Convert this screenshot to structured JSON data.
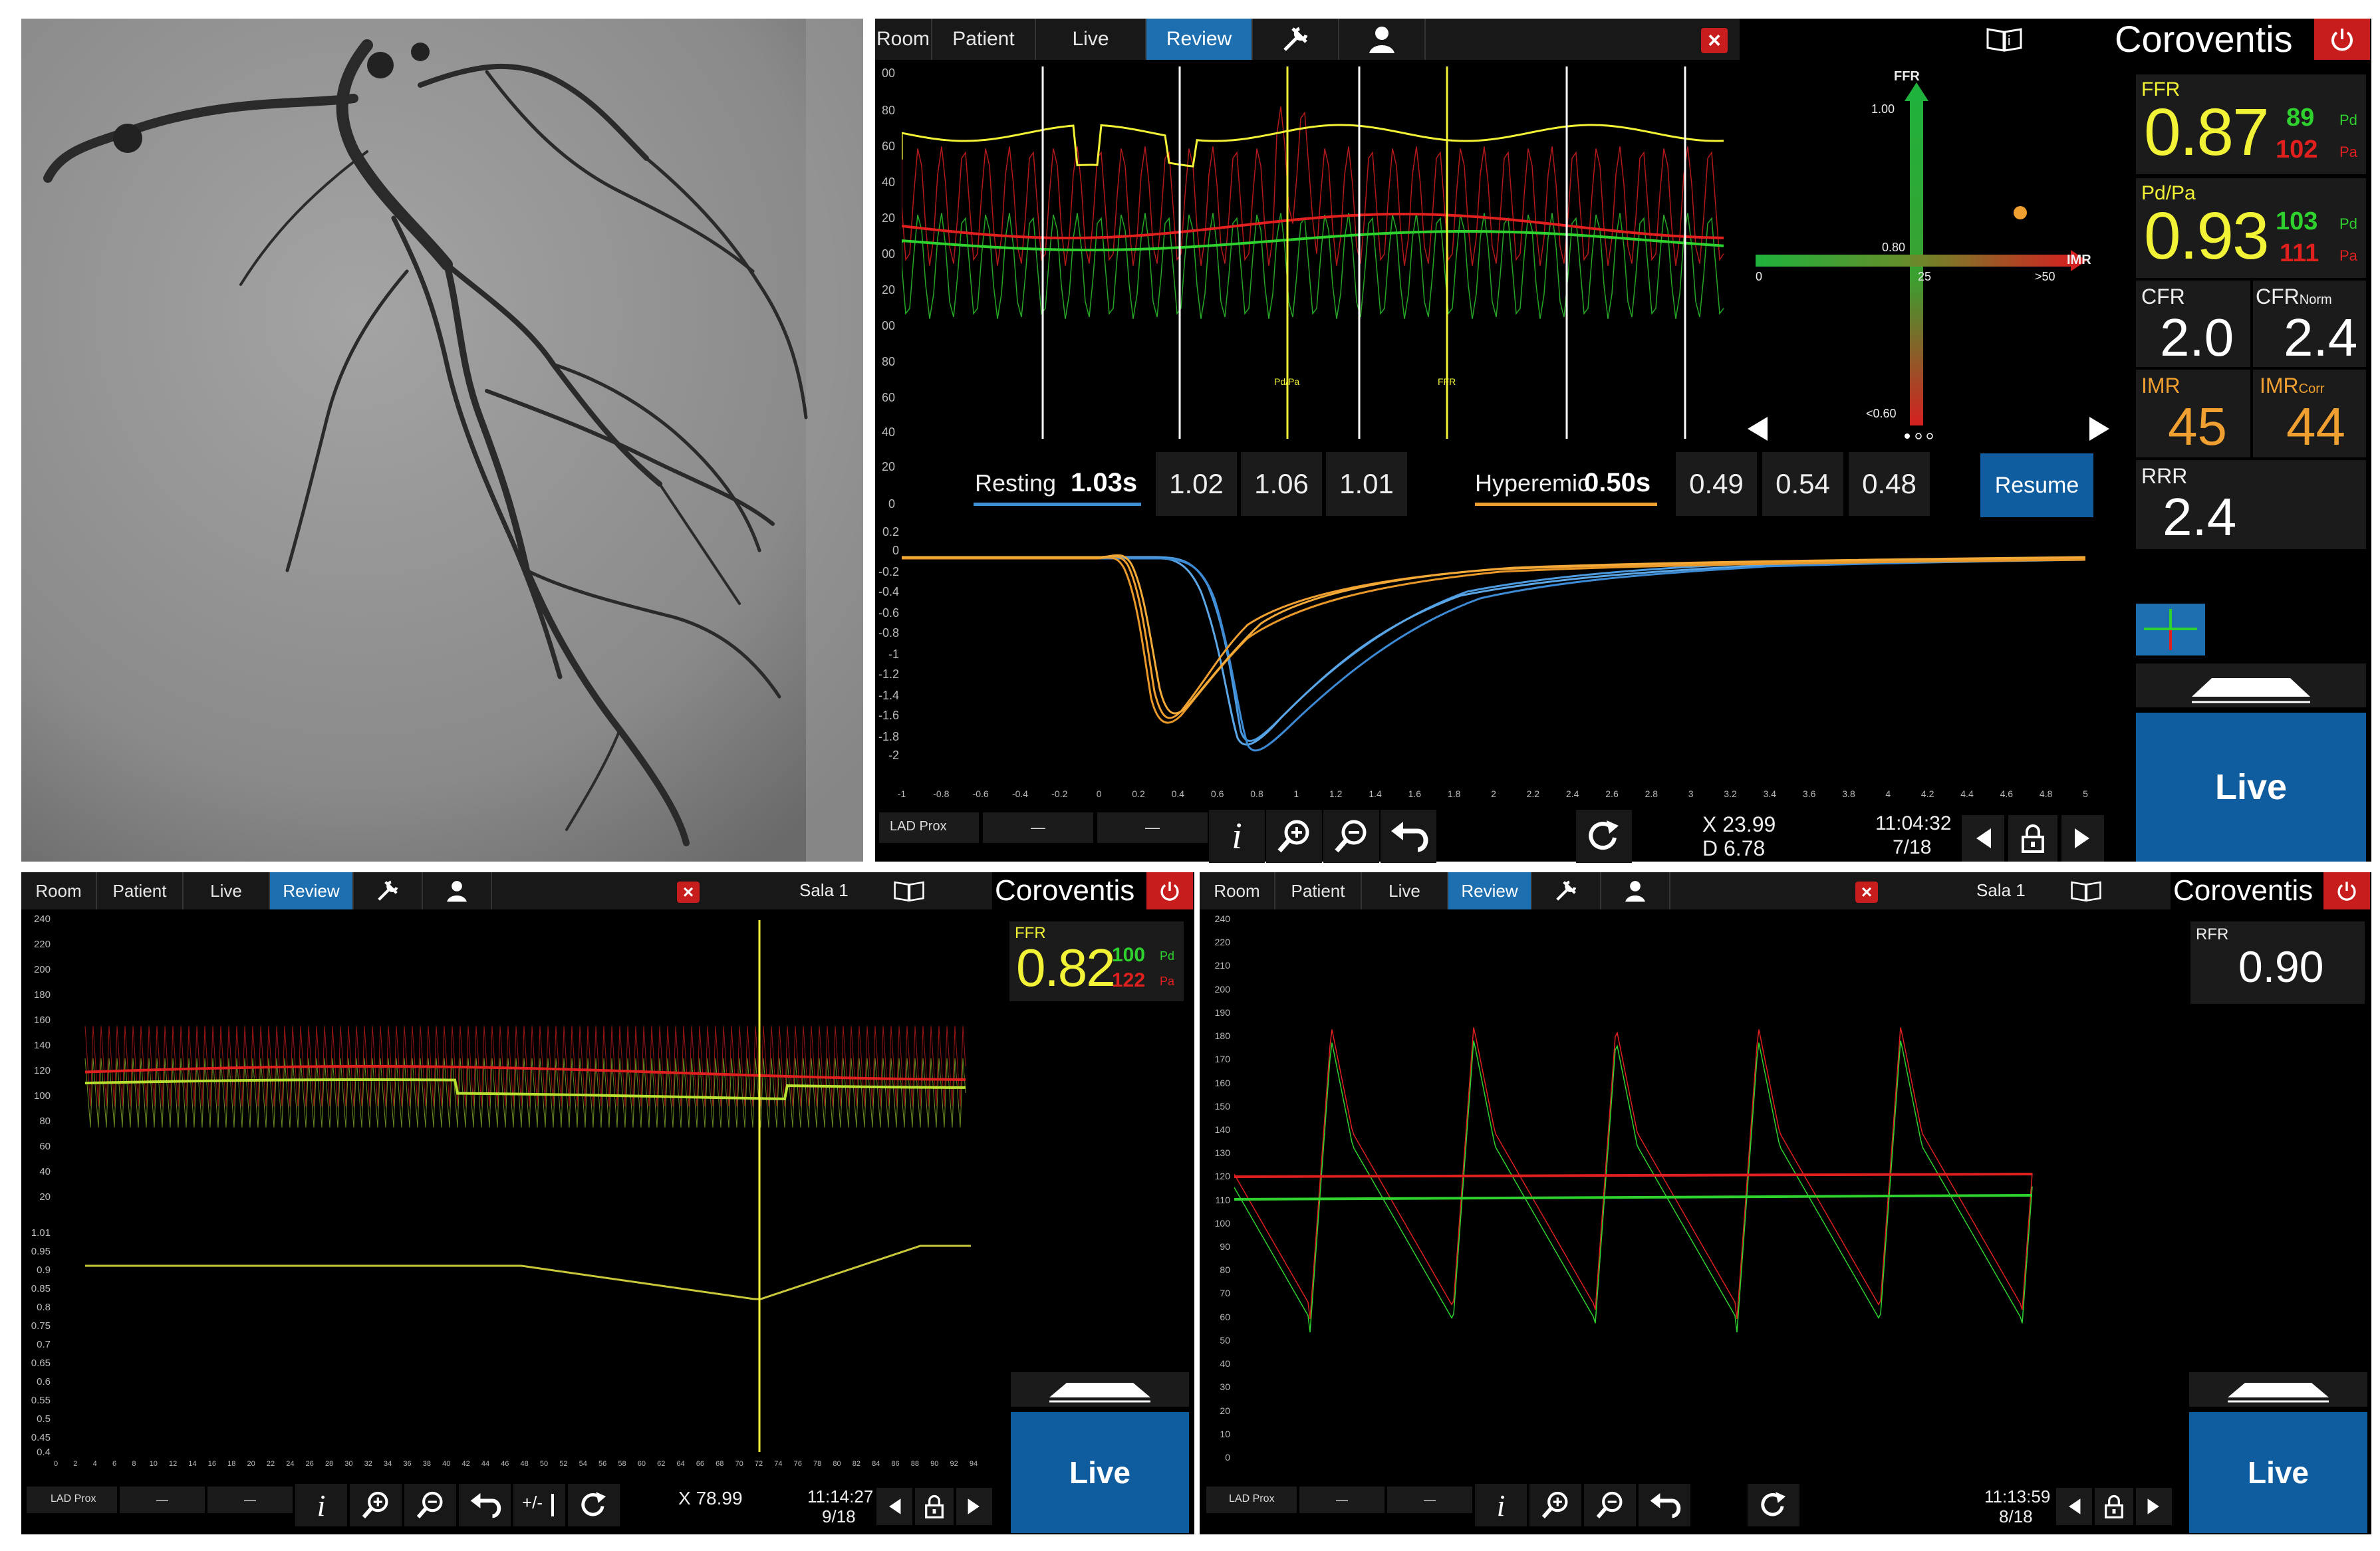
{
  "angio": {
    "alt": "Coronary angiogram"
  },
  "top": {
    "tabs": [
      "Room",
      "Patient",
      "Live",
      "Review"
    ],
    "close": "×",
    "brand": "Coroventis",
    "upper_axis": [
      "00",
      "80",
      "60",
      "40",
      "20",
      "00",
      "20",
      "00",
      "80",
      "60",
      "40",
      "20",
      "0"
    ],
    "plot_markers": [
      "Pd/Pa",
      "FFR"
    ],
    "quadrant": {
      "y_title": "FFR",
      "y_top": "1.00",
      "y_mid": "0.80",
      "y_bottom": "<0.60",
      "x_title": "IMR",
      "x_left": "0",
      "x_mid": "25",
      "x_right": ">50"
    },
    "resting_label": "Resting",
    "resting_value": "1.03s",
    "resting_values": [
      "1.02",
      "1.06",
      "1.01"
    ],
    "hyperemic_label": "Hyperemic",
    "hyperemic_value": "0.50s",
    "hyperemic_values": [
      "0.49",
      "0.54",
      "0.48"
    ],
    "resume": "Resume",
    "lower_y": [
      "0.2",
      "0",
      "-0.2",
      "-0.4",
      "-0.6",
      "-0.8",
      "-1",
      "-1.2",
      "-1.4",
      "-1.6",
      "-1.8",
      "-2"
    ],
    "lower_x": [
      "-1",
      "-0.8",
      "-0.6",
      "-0.4",
      "-0.2",
      "0",
      "0.2",
      "0.4",
      "0.6",
      "0.8",
      "1",
      "1.2",
      "1.4",
      "1.6",
      "1.8",
      "2",
      "2.2",
      "2.4",
      "2.6",
      "2.8",
      "3",
      "3.2",
      "3.4",
      "3.6",
      "3.8",
      "4",
      "4.2",
      "4.4",
      "4.6",
      "4.8",
      "5"
    ],
    "location": "LAD Prox",
    "dash1": "—",
    "dash2": "—",
    "x_readout": "X 23.99",
    "d_readout": "D 6.78",
    "time": "11:04:32",
    "date": "7/18"
  },
  "side": {
    "ffr_label": "FFR",
    "ffr": "0.87",
    "ffr_pd": "89",
    "ffr_pa": "102",
    "pdpa_label": "Pd/Pa",
    "pdpa": "0.93",
    "pdpa_pd": "103",
    "pdpa_pa": "111",
    "pd": "Pd",
    "pa": "Pa",
    "cfr_label": "CFR",
    "cfr": "2.0",
    "cfrnorm_label": "CFR",
    "cfrnorm_sub": "Norm",
    "cfrnorm": "2.4",
    "imr_label": "IMR",
    "imr": "45",
    "imrcorr_label": "IMR",
    "imrcorr_sub": "Corr",
    "imrcorr": "44",
    "rrr_label": "RRR",
    "rrr": "2.4",
    "live": "Live"
  },
  "bl": {
    "tabs": [
      "Room",
      "Patient",
      "Live",
      "Review"
    ],
    "close": "×",
    "room_name": "Sala 1",
    "brand": "Coroventis",
    "ffr_label": "FFR",
    "ffr": "0.82",
    "pd": "100",
    "pa": "122",
    "pd_l": "Pd",
    "pa_l": "Pa",
    "y_upper": [
      "240",
      "220",
      "200",
      "180",
      "160",
      "140",
      "120",
      "100",
      "80",
      "60",
      "40",
      "20"
    ],
    "y_lower": [
      "1.01",
      "0.95",
      "0.9",
      "0.85",
      "0.8",
      "0.75",
      "0.7",
      "0.65",
      "0.6",
      "0.55",
      "0.5",
      "0.45",
      "0.4"
    ],
    "x_axis": [
      "0",
      "2",
      "4",
      "6",
      "8",
      "10",
      "12",
      "14",
      "16",
      "18",
      "20",
      "22",
      "24",
      "26",
      "28",
      "30",
      "32",
      "34",
      "36",
      "38",
      "40",
      "42",
      "44",
      "46",
      "48",
      "50",
      "52",
      "54",
      "56",
      "58",
      "60",
      "62",
      "64",
      "66",
      "68",
      "70",
      "72",
      "74",
      "76",
      "78",
      "80",
      "82",
      "84",
      "86",
      "88",
      "90",
      "92",
      "94"
    ],
    "location": "LAD Prox",
    "dash1": "—",
    "dash2": "—",
    "x_readout": "X 78.99",
    "time": "11:14:27",
    "date": "9/18",
    "live": "Live"
  },
  "br": {
    "tabs": [
      "Room",
      "Patient",
      "Live",
      "Review"
    ],
    "close": "×",
    "room_name": "Sala 1",
    "brand": "Coroventis",
    "rfr_label": "RFR",
    "rfr": "0.90",
    "y_axis": [
      "240",
      "220",
      "210",
      "200",
      "190",
      "180",
      "170",
      "160",
      "150",
      "140",
      "130",
      "120",
      "110",
      "100",
      "90",
      "80",
      "70",
      "60",
      "50",
      "40",
      "30",
      "20",
      "10",
      "0"
    ],
    "location": "LAD Prox",
    "dash1": "—",
    "dash2": "—",
    "time": "11:13:59",
    "date": "8/18",
    "live": "Live"
  },
  "colors": {
    "accent": "#1d6fb0",
    "pd": "#2ed12e",
    "pa": "#e01f1f",
    "ffr": "#f2f236",
    "imr": "#f0a030",
    "close": "#c81d1d"
  }
}
